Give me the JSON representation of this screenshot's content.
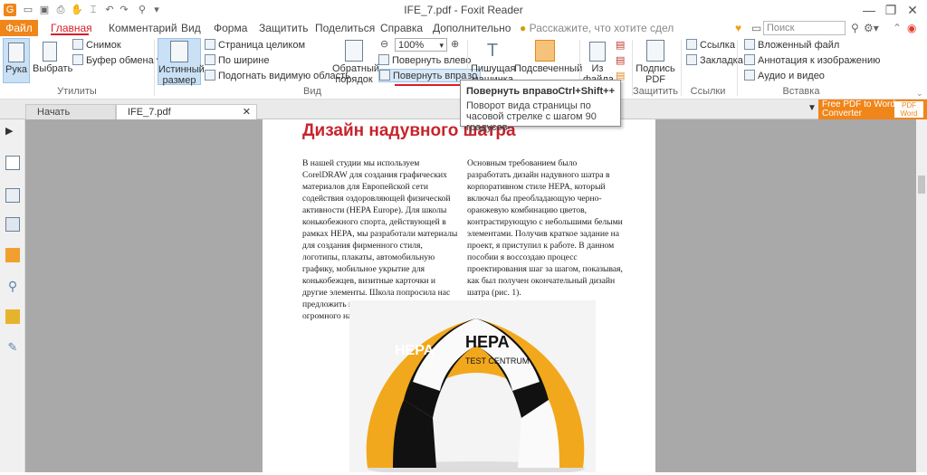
{
  "window": {
    "title": "IFE_7.pdf - Foxit Reader",
    "controls": [
      "minimize",
      "restore",
      "close"
    ]
  },
  "menu": {
    "tabs": [
      "Файл",
      "Главная",
      "Комментарий",
      "Вид",
      "Форма",
      "Защитить",
      "Поделиться",
      "Справка",
      "Дополнительно"
    ],
    "tell_me": "Расскажите, что хотите сдел",
    "search_placeholder": "Поиск"
  },
  "ribbon": {
    "hand": "Рука",
    "select": "Выбрать",
    "snapshot": "Снимок",
    "clipboard": "Буфер обмена",
    "group_tools": "Утилиты",
    "actual_size_line1": "Истинный",
    "actual_size_line2": "размер",
    "fit_page": "Страница целиком",
    "fit_width": "По ширине",
    "fit_visible": "Подогнать видимую область",
    "reflow_line1": "Обратный",
    "reflow_line2": "порядок",
    "zoom_value": "100%",
    "rotate_left": "Повернуть влево",
    "rotate_right": "Повернуть вправо",
    "group_view": "Вид",
    "typewriter_line1": "Пишущая",
    "typewriter_line2": "машинка",
    "highlight": "Подсвеченный",
    "from_file_line1": "Из",
    "from_file_line2": "файла",
    "sign_line1": "Подпись",
    "sign_line2": "PDF",
    "group_protect": "Защитить",
    "link": "Ссылка",
    "bookmark": "Закладка",
    "group_links": "Ссылки",
    "attached_file": "Вложенный файл",
    "image_annotation": "Аннотация к изображению",
    "audio_video": "Аудио и видео",
    "group_insert": "Вставка"
  },
  "tooltip": {
    "title": "Повернуть вправо",
    "shortcut": "Ctrl+Shift++",
    "description": "Поворот вида страницы по часовой стрелке с шагом 90 градусов"
  },
  "doc_tabs": {
    "start": "Начать",
    "current": "IFE_7.pdf",
    "promo_line1": "Free PDF to Word",
    "promo_line2": "Converter",
    "promo_badge": "PDF Word"
  },
  "document": {
    "heading": "Дизайн надувного шатра",
    "col1": "В нашей студии мы используем CorelDRAW для создания графических материалов для Европейской сети содействия оздоровляющей физической активности (HEPA Europe). Для школы конькобежного спорта, действующей в рамках HEPA, мы разработали материалы для создания фирменного стиля, логотипы, плакаты, автомобильную графику, мобильное укрытие для конькобежцев, визитные карточки и другие элементы. Школа попросила нас предложить графический дизайн для огромного надувного шатра.",
    "col2": "Основным требованием было разработать дизайн надувного шатра в корпоративном стиле HEPA, который включал бы преобладающую черно-оранжевую комбинацию цветов, контрастирующую с небольшими белыми элементами. Получив краткое задание на проект, я приступил к работе. В данном пособии я воссоздаю процесс проектирования шаг за шагом, показывая, как был получен окончательный дизайн шатра (рис. 1).",
    "tent_brand1": "HEPA",
    "tent_brand2": "HEPA",
    "tent_label": "TEST CENTRUM"
  },
  "colors": {
    "accent": "#f08519",
    "heading": "#c8232c",
    "active_tab": "#d61f26"
  }
}
